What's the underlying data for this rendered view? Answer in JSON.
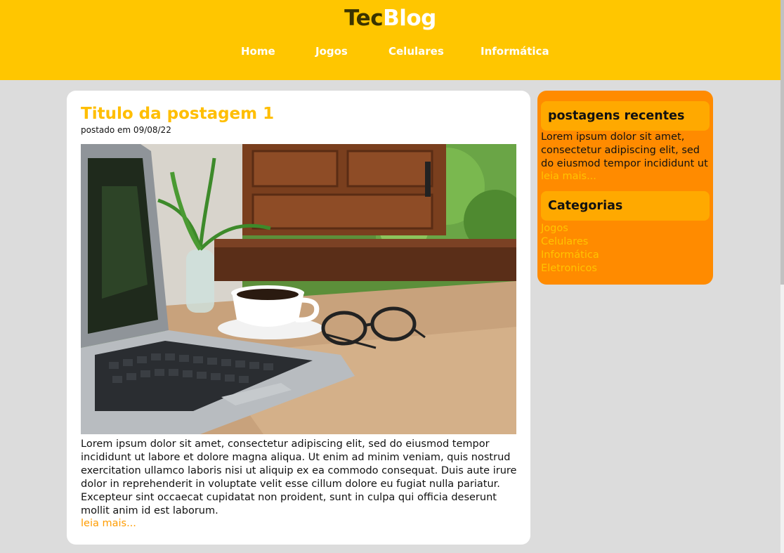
{
  "header": {
    "logo_part1": "Tec",
    "logo_part2": "Blog",
    "nav": [
      "Home",
      "Jogos",
      "Celulares",
      "Informática"
    ]
  },
  "post": {
    "title": "Titulo da postagem 1",
    "meta": "postado em 09/08/22",
    "body": "Lorem ipsum dolor sit amet, consectetur adipiscing elit, sed do eiusmod tempor incididunt ut labore et dolore magna aliqua. Ut enim ad minim veniam, quis nostrud exercitation ullamco laboris nisi ut aliquip ex ea commodo consequat. Duis aute irure dolor in reprehenderit in voluptate velit esse cillum dolore eu fugiat nulla pariatur. Excepteur sint occaecat cupidatat non proident, sunt in culpa qui officia deserunt mollit anim id est laborum.",
    "read_more": "leia mais..."
  },
  "sidebar": {
    "recent_title": "postagens recentes",
    "recent_text": "Lorem ipsum dolor sit amet, consectetur adipiscing elit, sed do eiusmod tempor incididunt ut",
    "recent_more": "leia mais...",
    "categories_title": "Categorias",
    "categories": [
      "Jogos",
      "Celulares",
      "Informática",
      "Eletronicos"
    ]
  },
  "colors": {
    "header_bg": "#ffc600",
    "accent_title": "#ffbe00",
    "sidebar_bg": "#ff8b00",
    "sidebar_head_bg": "#ffa900",
    "link_yellow": "#ffc400",
    "link_orange": "#ff9c00",
    "page_bg": "#dcdcdc"
  }
}
